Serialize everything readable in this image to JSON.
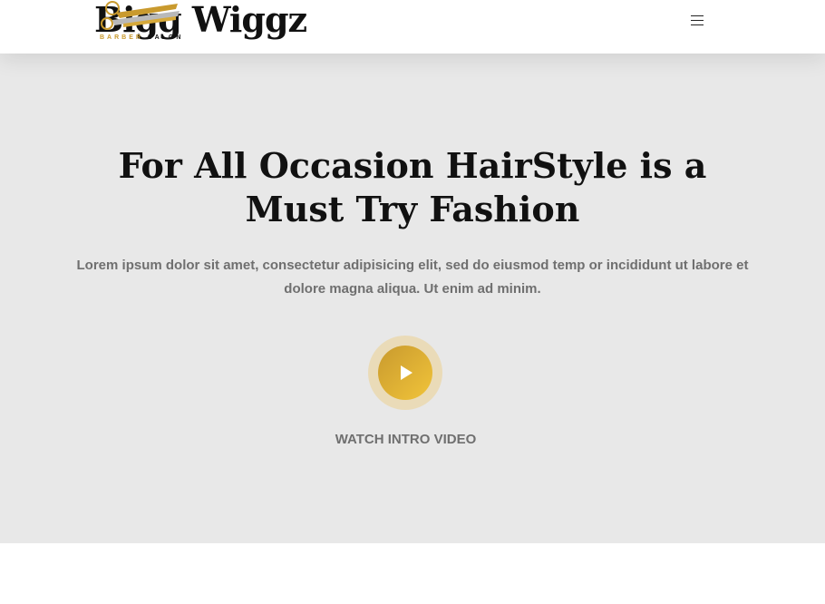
{
  "header": {
    "logo": {
      "name": "Bigg Wiggz",
      "tagline_left": "BARBER",
      "tagline_right": "SALON",
      "icon": "scissors-comb-icon"
    },
    "menu_icon": "hamburger-menu-icon"
  },
  "hero": {
    "title": "For All Occasion HairStyle is a Must Try Fashion",
    "text": "Lorem ipsum dolor sit amet, consectetur adipisicing elit, sed do eiusmod temp or incididunt ut labore et dolore magna aliqua. Ut enim ad minim.",
    "play_icon": "play-icon",
    "watch_label": "WATCH INTRO VIDEO"
  },
  "colors": {
    "accent_gold": "#c99a2e",
    "accent_gold_light": "#f1c43a",
    "hero_background": "#e8e8e8",
    "text_muted": "#6f6f6f",
    "heading": "#111111"
  }
}
